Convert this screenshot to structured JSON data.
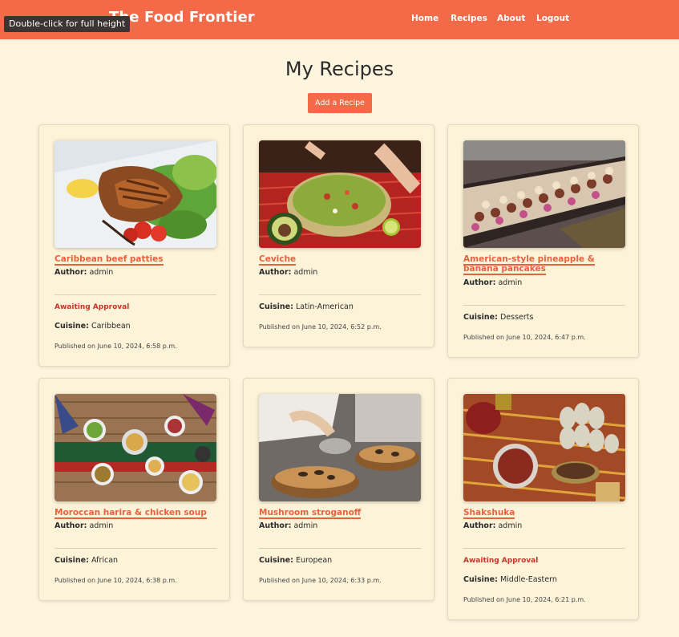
{
  "header": {
    "brand": "The Food Frontier",
    "tooltip": "Double-click for full height",
    "nav": [
      {
        "label": "Home"
      },
      {
        "label": "Recipes"
      },
      {
        "label": "About"
      },
      {
        "label": "Logout"
      }
    ]
  },
  "main": {
    "title": "My Recipes",
    "add_button": "Add a Recipe",
    "author_label": "Author:",
    "cuisine_label": "Cuisine:",
    "recipes": [
      {
        "title": "Caribbean beef patties",
        "author": "admin",
        "status": "Awaiting Approval",
        "cuisine": "Caribbean",
        "published": "Published on June 10, 2024, 6:58 p.m.",
        "image_icon": "grilled-fish-photo"
      },
      {
        "title": "Ceviche",
        "author": "admin",
        "status": "",
        "cuisine": "Latin-American",
        "published": "Published on June 10, 2024, 6:52 p.m.",
        "image_icon": "guacamole-bowl-photo"
      },
      {
        "title": "American-style pineapple & banana pancakes",
        "author": "admin",
        "status": "",
        "cuisine": "Desserts",
        "published": "Published on June 10, 2024, 6:47 p.m.",
        "image_icon": "pastry-display-photo"
      },
      {
        "title": "Moroccan harira & chicken soup",
        "author": "admin",
        "status": "",
        "cuisine": "African",
        "published": "Published on June 10, 2024, 6:38 p.m.",
        "image_icon": "table-spread-photo"
      },
      {
        "title": "Mushroom stroganoff",
        "author": "admin",
        "status": "",
        "cuisine": "European",
        "published": "Published on June 10, 2024, 6:33 p.m.",
        "image_icon": "chef-plating-photo"
      },
      {
        "title": "Shakshuka",
        "author": "admin",
        "status": "Awaiting Approval",
        "cuisine": "Middle-Eastern",
        "published": "Published on June 10, 2024, 6:21 p.m.",
        "image_icon": "spices-garlic-photo"
      }
    ]
  },
  "colors": {
    "accent": "#f26a47",
    "background": "#fdf5dd",
    "status_red": "#c8342a"
  }
}
